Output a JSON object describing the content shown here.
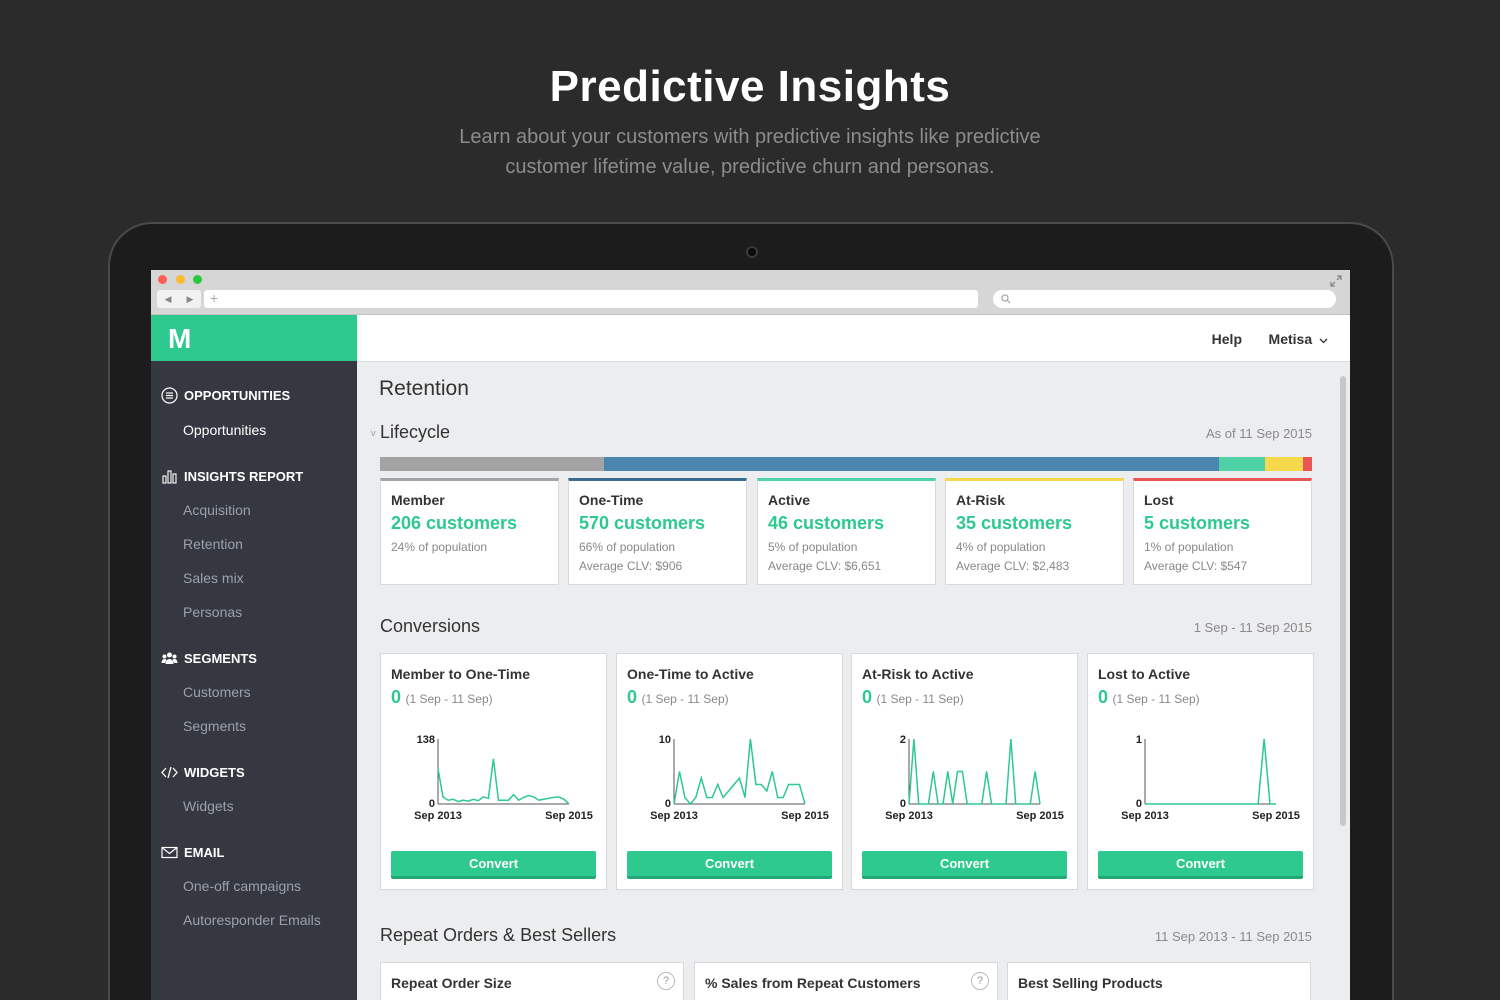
{
  "hero": {
    "title": "Predictive Insights",
    "subtitle_line1": "Learn about your customers with predictive insights like predictive",
    "subtitle_line2": "customer lifetime value, predictive churn and personas."
  },
  "browser": {
    "nav_back": "◀",
    "nav_forward": "▶",
    "new_tab": "+",
    "search_icon": "magnifier-icon",
    "expand_icon": "expand-icon"
  },
  "sidebar": {
    "logo": "M",
    "sections": [
      {
        "label": "OPPORTUNITIES",
        "icon": "list-circle-icon",
        "items": [
          "Opportunities"
        ]
      },
      {
        "label": "INSIGHTS REPORT",
        "icon": "bar-chart-icon",
        "items": [
          "Acquisition",
          "Retention",
          "Sales mix",
          "Personas"
        ]
      },
      {
        "label": "SEGMENTS",
        "icon": "users-icon",
        "items": [
          "Customers",
          "Segments"
        ]
      },
      {
        "label": "WIDGETS",
        "icon": "code-icon",
        "items": [
          "Widgets"
        ]
      },
      {
        "label": "EMAIL",
        "icon": "envelope-icon",
        "items": [
          "One-off campaigns",
          "Autoresponder Emails"
        ]
      }
    ]
  },
  "topbar": {
    "help": "Help",
    "user": "Metisa"
  },
  "page": {
    "title": "Retention"
  },
  "lifecycle": {
    "title": "Lifecycle",
    "date": "As of 11 Sep 2015",
    "bar_colors": [
      "#a3a3a3",
      "#4a86b0",
      "#4fd3a6",
      "#f6d94b",
      "#ea5557"
    ],
    "bar_shares": [
      24,
      66,
      5,
      4,
      1
    ],
    "cards": [
      {
        "name": "Member",
        "count": "206 customers",
        "pct": "24% of population",
        "clv": "",
        "color": "#a3a3a3"
      },
      {
        "name": "One-Time",
        "count": "570 customers",
        "pct": "66% of population",
        "clv": "Average CLV: $906",
        "color": "#3b6d8f"
      },
      {
        "name": "Active",
        "count": "46 customers",
        "pct": "5% of population",
        "clv": "Average CLV: $6,651",
        "color": "#4fd3a6"
      },
      {
        "name": "At-Risk",
        "count": "35 customers",
        "pct": "4% of population",
        "clv": "Average CLV: $2,483",
        "color": "#f6d94b"
      },
      {
        "name": "Lost",
        "count": "5 customers",
        "pct": "1% of population",
        "clv": "Average CLV: $547",
        "color": "#ea5557"
      }
    ]
  },
  "conversions": {
    "title": "Conversions",
    "date": "1 Sep - 11 Sep 2015",
    "button_label": "Convert",
    "cards": [
      {
        "name": "Member to One-Time",
        "value": "0",
        "range": "(1 Sep - 11 Sep)"
      },
      {
        "name": "One-Time to Active",
        "value": "0",
        "range": "(1 Sep - 11 Sep)"
      },
      {
        "name": "At-Risk to Active",
        "value": "0",
        "range": "(1 Sep - 11 Sep)"
      },
      {
        "name": "Lost to Active",
        "value": "0",
        "range": "(1 Sep - 11 Sep)"
      }
    ]
  },
  "chart_data": [
    {
      "type": "line",
      "title": "Member to One-Time",
      "x_start": "Sep 2013",
      "x_end": "Sep 2015",
      "ylim": [
        0,
        138
      ],
      "values": [
        75,
        15,
        8,
        10,
        5,
        8,
        6,
        10,
        7,
        15,
        12,
        96,
        8,
        8,
        8,
        20,
        8,
        14,
        18,
        15,
        8,
        10,
        12,
        14,
        15,
        10,
        0
      ]
    },
    {
      "type": "line",
      "title": "One-Time to Active",
      "x_start": "Sep 2013",
      "x_end": "Sep 2015",
      "ylim": [
        0,
        10
      ],
      "values": [
        0,
        5,
        1,
        0,
        1,
        4,
        1,
        1,
        3,
        1,
        2,
        3,
        4,
        1,
        10,
        3,
        3,
        2,
        5,
        1,
        1,
        3,
        3,
        3,
        0
      ]
    },
    {
      "type": "line",
      "title": "At-Risk to Active",
      "x_start": "Sep 2013",
      "x_end": "Sep 2015",
      "ylim": [
        0,
        2
      ],
      "values": [
        0,
        2,
        0,
        0,
        0,
        1,
        0,
        0,
        1,
        0,
        1,
        1,
        0,
        0,
        0,
        0,
        1,
        0,
        0,
        0,
        0,
        2,
        0,
        0,
        0,
        0,
        1,
        0
      ]
    },
    {
      "type": "line",
      "title": "Lost to Active",
      "x_start": "Sep 2013",
      "x_end": "Sep 2015",
      "ylim": [
        0,
        1
      ],
      "values": [
        0,
        0,
        0,
        0,
        0,
        0,
        0,
        0,
        0,
        0,
        0,
        0,
        0,
        0,
        0,
        0,
        0,
        0,
        0,
        0,
        1,
        0,
        0
      ]
    }
  ],
  "repeat_orders": {
    "title": "Repeat Orders & Best Sellers",
    "date": "11 Sep 2013 - 11 Sep 2015",
    "cards": [
      {
        "name": "Repeat Order Size",
        "help": "?"
      },
      {
        "name": "% Sales from Repeat Customers",
        "help": "?"
      },
      {
        "name": "Best Selling Products",
        "help": ""
      }
    ]
  }
}
